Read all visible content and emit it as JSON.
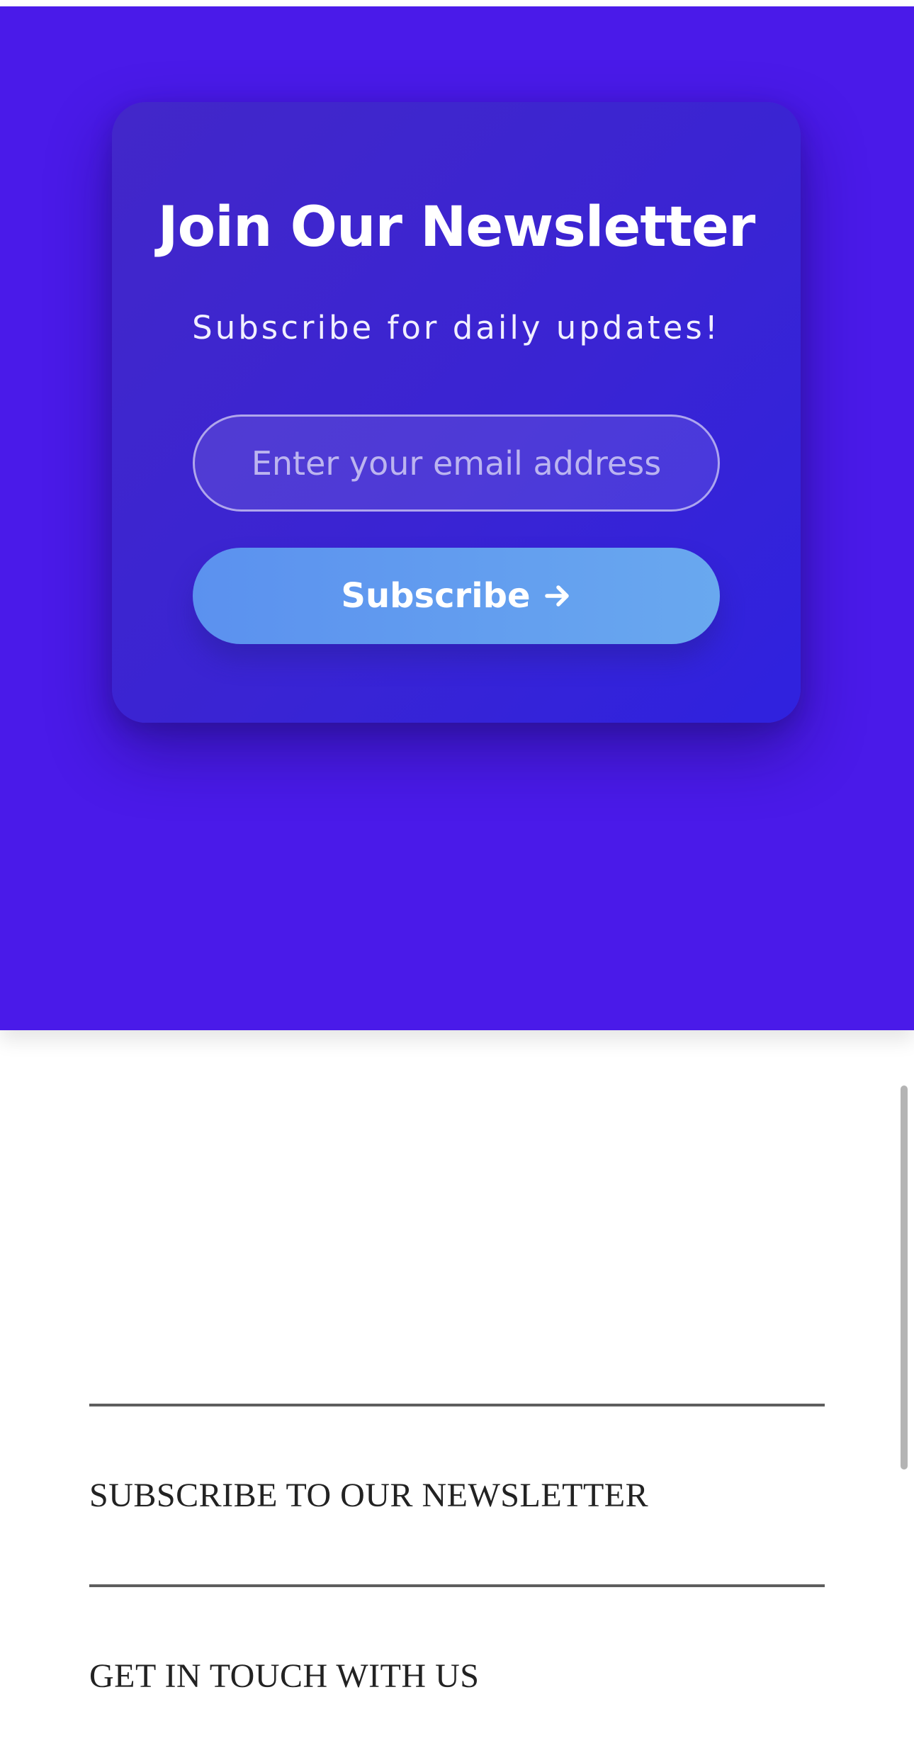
{
  "newsletter_card": {
    "title": "Join Our Newsletter",
    "subtitle": "Subscribe for daily updates!",
    "email_placeholder": "Enter your email address",
    "email_value": "",
    "subscribe_label": "Subscribe",
    "subscribe_icon": "arrow-right-icon"
  },
  "footer": {
    "sections": [
      {
        "heading": "SUBSCRIBE TO OUR NEWSLETTER"
      },
      {
        "heading": "GET IN TOUCH WITH US"
      }
    ]
  },
  "colors": {
    "hero_background": "#4a1ae9",
    "card_gradient_start": "#4227c9",
    "card_gradient_end": "#2f22df",
    "button_gradient_start": "#5b91ef",
    "button_gradient_end": "#69a8ef",
    "footer_text": "#222222",
    "divider": "#5e5e5e"
  }
}
